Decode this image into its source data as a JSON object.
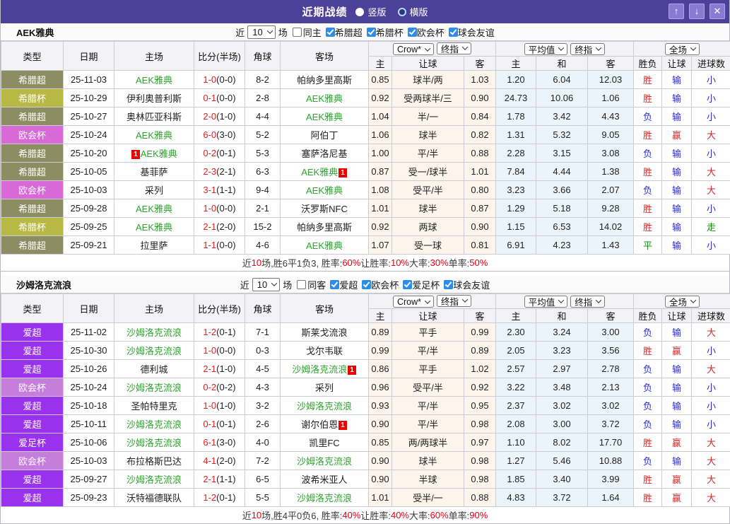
{
  "titlebar": {
    "title": "近期战绩",
    "radios": [
      {
        "label": "竖版",
        "selected": true
      },
      {
        "label": "横版",
        "selected": false
      }
    ],
    "buttons": {
      "up": "↑",
      "down": "↓",
      "close": "✕"
    },
    "bar_color": "#4c4099"
  },
  "table_header": {
    "type": "类型",
    "date": "日期",
    "home": "主场",
    "score": "比分(半场)",
    "corner": "角球",
    "away": "客场",
    "crow_select": "Crow*",
    "final_select": "终指",
    "avg_select": "平均值",
    "final_select2": "终指",
    "full_select": "全场",
    "sub": [
      "主",
      "让球",
      "客",
      "主",
      "和",
      "客",
      "胜负",
      "让球",
      "进球数"
    ]
  },
  "result_colors": {
    "胜": "res-r",
    "负": "res-b",
    "平": "res-g",
    "赢": "res-r",
    "输": "res-b",
    "走": "res-g",
    "大": "res-r",
    "小": "res-b"
  },
  "sections": [
    {
      "team": "AEK雅典",
      "filter": {
        "prefix": "近",
        "count": "10",
        "suffix": "场",
        "same_label": "同主",
        "same_checked": false,
        "leagues": [
          {
            "label": "希腊超",
            "checked": true
          },
          {
            "label": "希腊杯",
            "checked": true
          },
          {
            "label": "欧会杯",
            "checked": true
          },
          {
            "label": "球会友谊",
            "checked": true
          }
        ]
      },
      "rows": [
        {
          "type": "希腊超",
          "type_color": "#8d8d63",
          "date": "25-11-03",
          "home": "AEK雅典",
          "home_tracked": true,
          "home_badge": null,
          "score": "1-0",
          "half": "(0-0)",
          "corner": "8-2",
          "away": "帕纳多里高斯",
          "away_tracked": false,
          "away_badge": null,
          "crow": [
            "0.85",
            "球半/两",
            "1.03"
          ],
          "avg": [
            "1.20",
            "6.04",
            "12.03"
          ],
          "results": [
            "胜",
            "输",
            "小"
          ]
        },
        {
          "type": "希腊杯",
          "type_color": "#b8b845",
          "date": "25-10-29",
          "home": "伊利奥普利斯",
          "home_tracked": false,
          "home_badge": null,
          "score": "0-1",
          "half": "(0-0)",
          "corner": "2-8",
          "away": "AEK雅典",
          "away_tracked": true,
          "away_badge": null,
          "crow": [
            "0.92",
            "受两球半/三",
            "0.90"
          ],
          "avg": [
            "24.73",
            "10.06",
            "1.06"
          ],
          "results": [
            "胜",
            "输",
            "小"
          ]
        },
        {
          "type": "希腊超",
          "type_color": "#8d8d63",
          "date": "25-10-27",
          "home": "奥林匹亚科斯",
          "home_tracked": false,
          "home_badge": null,
          "score": "2-0",
          "half": "(1-0)",
          "corner": "4-4",
          "away": "AEK雅典",
          "away_tracked": true,
          "away_badge": null,
          "crow": [
            "1.04",
            "半/一",
            "0.84"
          ],
          "avg": [
            "1.78",
            "3.42",
            "4.43"
          ],
          "results": [
            "负",
            "输",
            "小"
          ]
        },
        {
          "type": "欧会杯",
          "type_color": "#d86ad8",
          "date": "25-10-24",
          "home": "AEK雅典",
          "home_tracked": true,
          "home_badge": null,
          "score": "6-0",
          "half": "(3-0)",
          "corner": "5-2",
          "away": "阿伯丁",
          "away_tracked": false,
          "away_badge": null,
          "crow": [
            "1.06",
            "球半",
            "0.82"
          ],
          "avg": [
            "1.31",
            "5.32",
            "9.05"
          ],
          "results": [
            "胜",
            "赢",
            "大"
          ]
        },
        {
          "type": "希腊超",
          "type_color": "#8d8d63",
          "date": "25-10-20",
          "home": "AEK雅典",
          "home_tracked": true,
          "home_badge": {
            "text": "1",
            "pos": "before"
          },
          "score": "0-2",
          "half": "(0-1)",
          "corner": "5-3",
          "away": "塞萨洛尼基",
          "away_tracked": false,
          "away_badge": null,
          "crow": [
            "1.00",
            "平/半",
            "0.88"
          ],
          "avg": [
            "2.28",
            "3.15",
            "3.08"
          ],
          "results": [
            "负",
            "输",
            "小"
          ]
        },
        {
          "type": "希腊超",
          "type_color": "#8d8d63",
          "date": "25-10-05",
          "home": "基菲萨",
          "home_tracked": false,
          "home_badge": null,
          "score": "2-3",
          "half": "(2-1)",
          "corner": "6-3",
          "away": "AEK雅典",
          "away_tracked": true,
          "away_badge": {
            "text": "1",
            "pos": "after"
          },
          "crow": [
            "0.87",
            "受一/球半",
            "1.01"
          ],
          "avg": [
            "7.84",
            "4.44",
            "1.38"
          ],
          "results": [
            "胜",
            "输",
            "大"
          ]
        },
        {
          "type": "欧会杯",
          "type_color": "#d86ad8",
          "date": "25-10-03",
          "home": "采列",
          "home_tracked": false,
          "home_badge": null,
          "score": "3-1",
          "half": "(1-1)",
          "corner": "9-4",
          "away": "AEK雅典",
          "away_tracked": true,
          "away_badge": null,
          "crow": [
            "1.08",
            "受平/半",
            "0.80"
          ],
          "avg": [
            "3.23",
            "3.66",
            "2.07"
          ],
          "results": [
            "负",
            "输",
            "大"
          ]
        },
        {
          "type": "希腊超",
          "type_color": "#8d8d63",
          "date": "25-09-28",
          "home": "AEK雅典",
          "home_tracked": true,
          "home_badge": null,
          "score": "1-0",
          "half": "(0-0)",
          "corner": "2-1",
          "away": "沃罗斯NFC",
          "away_tracked": false,
          "away_badge": null,
          "crow": [
            "1.01",
            "球半",
            "0.87"
          ],
          "avg": [
            "1.29",
            "5.18",
            "9.28"
          ],
          "results": [
            "胜",
            "输",
            "小"
          ]
        },
        {
          "type": "希腊杯",
          "type_color": "#b8b845",
          "date": "25-09-25",
          "home": "AEK雅典",
          "home_tracked": true,
          "home_badge": null,
          "score": "2-1",
          "half": "(2-0)",
          "corner": "15-2",
          "away": "帕纳多里高斯",
          "away_tracked": false,
          "away_badge": null,
          "crow": [
            "0.92",
            "两球",
            "0.90"
          ],
          "avg": [
            "1.15",
            "6.53",
            "14.02"
          ],
          "results": [
            "胜",
            "输",
            "走"
          ]
        },
        {
          "type": "希腊超",
          "type_color": "#8d8d63",
          "date": "25-09-21",
          "home": "拉里萨",
          "home_tracked": false,
          "home_badge": null,
          "score": "1-1",
          "half": "(0-0)",
          "corner": "4-6",
          "away": "AEK雅典",
          "away_tracked": true,
          "away_badge": null,
          "crow": [
            "1.07",
            "受一球",
            "0.81"
          ],
          "avg": [
            "6.91",
            "4.23",
            "1.43"
          ],
          "results": [
            "平",
            "输",
            "小"
          ]
        }
      ],
      "summary": [
        [
          "近",
          false
        ],
        [
          "10",
          true
        ],
        [
          "场,胜6平1负3, 胜率:",
          false
        ],
        [
          "60%",
          true
        ],
        [
          " 让胜率:",
          false
        ],
        [
          "10%",
          true
        ],
        [
          " 大率:",
          false
        ],
        [
          "30%",
          true
        ],
        [
          " 单率:",
          false
        ],
        [
          "50%",
          true
        ]
      ]
    },
    {
      "team": "沙姆洛克流浪",
      "filter": {
        "prefix": "近",
        "count": "10",
        "suffix": "场",
        "same_label": "同客",
        "same_checked": false,
        "leagues": [
          {
            "label": "爱超",
            "checked": true
          },
          {
            "label": "欧会杯",
            "checked": true
          },
          {
            "label": "爱足杯",
            "checked": true
          },
          {
            "label": "球会友谊",
            "checked": true
          }
        ]
      },
      "rows": [
        {
          "type": "爱超",
          "type_color": "#9932ee",
          "date": "25-11-02",
          "home": "沙姆洛克流浪",
          "home_tracked": true,
          "home_badge": null,
          "score": "1-2",
          "half": "(0-1)",
          "corner": "7-1",
          "away": "斯莱戈流浪",
          "away_tracked": false,
          "away_badge": null,
          "crow": [
            "0.89",
            "平手",
            "0.99"
          ],
          "avg": [
            "2.30",
            "3.24",
            "3.00"
          ],
          "results": [
            "负",
            "输",
            "大"
          ]
        },
        {
          "type": "爱超",
          "type_color": "#9932ee",
          "date": "25-10-30",
          "home": "沙姆洛克流浪",
          "home_tracked": true,
          "home_badge": null,
          "score": "1-0",
          "half": "(0-0)",
          "corner": "0-3",
          "away": "戈尔韦联",
          "away_tracked": false,
          "away_badge": null,
          "crow": [
            "0.99",
            "平/半",
            "0.89"
          ],
          "avg": [
            "2.05",
            "3.23",
            "3.56"
          ],
          "results": [
            "胜",
            "赢",
            "小"
          ]
        },
        {
          "type": "爱超",
          "type_color": "#9932ee",
          "date": "25-10-26",
          "home": "德利城",
          "home_tracked": false,
          "home_badge": null,
          "score": "2-1",
          "half": "(1-0)",
          "corner": "4-5",
          "away": "沙姆洛克流浪",
          "away_tracked": true,
          "away_badge": {
            "text": "1",
            "pos": "after"
          },
          "crow": [
            "0.86",
            "平手",
            "1.02"
          ],
          "avg": [
            "2.57",
            "2.97",
            "2.78"
          ],
          "results": [
            "负",
            "输",
            "大"
          ]
        },
        {
          "type": "欧会杯",
          "type_color": "#c67edd",
          "date": "25-10-24",
          "home": "沙姆洛克流浪",
          "home_tracked": true,
          "home_badge": null,
          "score": "0-2",
          "half": "(0-2)",
          "corner": "4-3",
          "away": "采列",
          "away_tracked": false,
          "away_badge": null,
          "crow": [
            "0.96",
            "受平/半",
            "0.92"
          ],
          "avg": [
            "3.22",
            "3.48",
            "2.13"
          ],
          "results": [
            "负",
            "输",
            "小"
          ]
        },
        {
          "type": "爱超",
          "type_color": "#9932ee",
          "date": "25-10-18",
          "home": "圣帕特里克",
          "home_tracked": false,
          "home_badge": null,
          "score": "1-0",
          "half": "(1-0)",
          "corner": "3-2",
          "away": "沙姆洛克流浪",
          "away_tracked": true,
          "away_badge": null,
          "crow": [
            "0.93",
            "平/半",
            "0.95"
          ],
          "avg": [
            "2.37",
            "3.02",
            "3.02"
          ],
          "results": [
            "负",
            "输",
            "小"
          ]
        },
        {
          "type": "爱超",
          "type_color": "#9932ee",
          "date": "25-10-11",
          "home": "沙姆洛克流浪",
          "home_tracked": true,
          "home_badge": null,
          "score": "0-1",
          "half": "(0-1)",
          "corner": "2-6",
          "away": "谢尔伯恩",
          "away_tracked": false,
          "away_badge": {
            "text": "1",
            "pos": "after"
          },
          "crow": [
            "0.90",
            "平/半",
            "0.98"
          ],
          "avg": [
            "2.08",
            "3.00",
            "3.72"
          ],
          "results": [
            "负",
            "输",
            "小"
          ]
        },
        {
          "type": "爱足杯",
          "type_color": "#9932ee",
          "date": "25-10-06",
          "home": "沙姆洛克流浪",
          "home_tracked": true,
          "home_badge": null,
          "score": "6-1",
          "half": "(3-0)",
          "corner": "4-0",
          "away": "凯里FC",
          "away_tracked": false,
          "away_badge": null,
          "crow": [
            "0.85",
            "两/两球半",
            "0.97"
          ],
          "avg": [
            "1.10",
            "8.02",
            "17.70"
          ],
          "results": [
            "胜",
            "赢",
            "大"
          ]
        },
        {
          "type": "欧会杯",
          "type_color": "#c67edd",
          "date": "25-10-03",
          "home": "布拉格斯巴达",
          "home_tracked": false,
          "home_badge": null,
          "score": "4-1",
          "half": "(2-0)",
          "corner": "7-2",
          "away": "沙姆洛克流浪",
          "away_tracked": true,
          "away_badge": null,
          "crow": [
            "0.90",
            "球半",
            "0.98"
          ],
          "avg": [
            "1.27",
            "5.46",
            "10.88"
          ],
          "results": [
            "负",
            "输",
            "大"
          ]
        },
        {
          "type": "爱超",
          "type_color": "#9932ee",
          "date": "25-09-27",
          "home": "沙姆洛克流浪",
          "home_tracked": true,
          "home_badge": null,
          "score": "2-1",
          "half": "(1-1)",
          "corner": "6-5",
          "away": "波希米亚人",
          "away_tracked": false,
          "away_badge": null,
          "crow": [
            "0.90",
            "半球",
            "0.98"
          ],
          "avg": [
            "1.85",
            "3.40",
            "3.99"
          ],
          "results": [
            "胜",
            "赢",
            "大"
          ]
        },
        {
          "type": "爱超",
          "type_color": "#9932ee",
          "date": "25-09-23",
          "home": "沃特福德联队",
          "home_tracked": false,
          "home_badge": null,
          "score": "1-2",
          "half": "(0-1)",
          "corner": "5-5",
          "away": "沙姆洛克流浪",
          "away_tracked": true,
          "away_badge": null,
          "crow": [
            "1.01",
            "受半/一",
            "0.88"
          ],
          "avg": [
            "4.83",
            "3.72",
            "1.64"
          ],
          "results": [
            "胜",
            "赢",
            "大"
          ]
        }
      ],
      "summary": [
        [
          "近",
          false
        ],
        [
          "10",
          true
        ],
        [
          "场,胜4平0负6, 胜率:",
          false
        ],
        [
          "40%",
          true
        ],
        [
          " 让胜率:",
          false
        ],
        [
          "40%",
          true
        ],
        [
          " 大率:",
          false
        ],
        [
          "60%",
          true
        ],
        [
          " 单率:",
          false
        ],
        [
          "90%",
          true
        ]
      ]
    }
  ]
}
